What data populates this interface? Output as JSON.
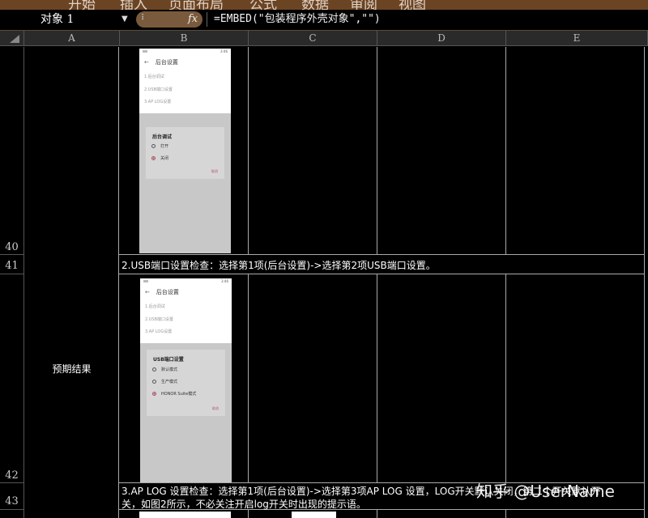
{
  "ribbon": {
    "tabs": [
      "开始",
      "插入",
      "页面布局",
      "公式",
      "数据",
      "审阅",
      "视图"
    ]
  },
  "formula_bar": {
    "name_box": "对象 1",
    "fx_label": "fx",
    "formula": "=EMBED(\"包装程序外壳对象\",\"\")"
  },
  "columns": [
    "A",
    "B",
    "C",
    "D",
    "E"
  ],
  "rows": {
    "r40": "40",
    "r41": "41",
    "r42": "42",
    "r43": "43"
  },
  "cells": {
    "a_label": "预期结果",
    "row41_text": "2.USB端口设置检查：选择第1项(后台设置)->选择第2项USB端口设置。",
    "row43_line1": "3.AP LOG 设置检查：选择第1项(后台设置)->选择第3项AP LOG 设置，LOG开关默认关闭，第二个开关默认开",
    "row43_line2": "关，如图2所示，不必关注开启log开关时出现的提示语。"
  },
  "phone1": {
    "time": "3:46",
    "title": "后台设置",
    "items": [
      "1.后台调试",
      "2.USB端口设置",
      "3.AP LOG设置"
    ],
    "dialog_title": "后台调试",
    "options": [
      {
        "label": "打开",
        "selected": false
      },
      {
        "label": "关闭",
        "selected": true
      }
    ],
    "cancel": "取消"
  },
  "phone2": {
    "time": "3:46",
    "title": "后台设置",
    "items": [
      "1.后台调试",
      "2.USB端口设置",
      "3.AP LOG设置"
    ],
    "dialog_title": "USB端口设置",
    "options": [
      {
        "label": "默认模式",
        "selected": false
      },
      {
        "label": "生产模式",
        "selected": false
      },
      {
        "label": "HONOR Suite模式",
        "selected": true
      }
    ],
    "cancel": "取消"
  },
  "watermark": "知乎 @UserName",
  "colors": {
    "ribbon": "#6b4424",
    "grid": "#aaaaaa",
    "radio_on": "#b05060"
  }
}
